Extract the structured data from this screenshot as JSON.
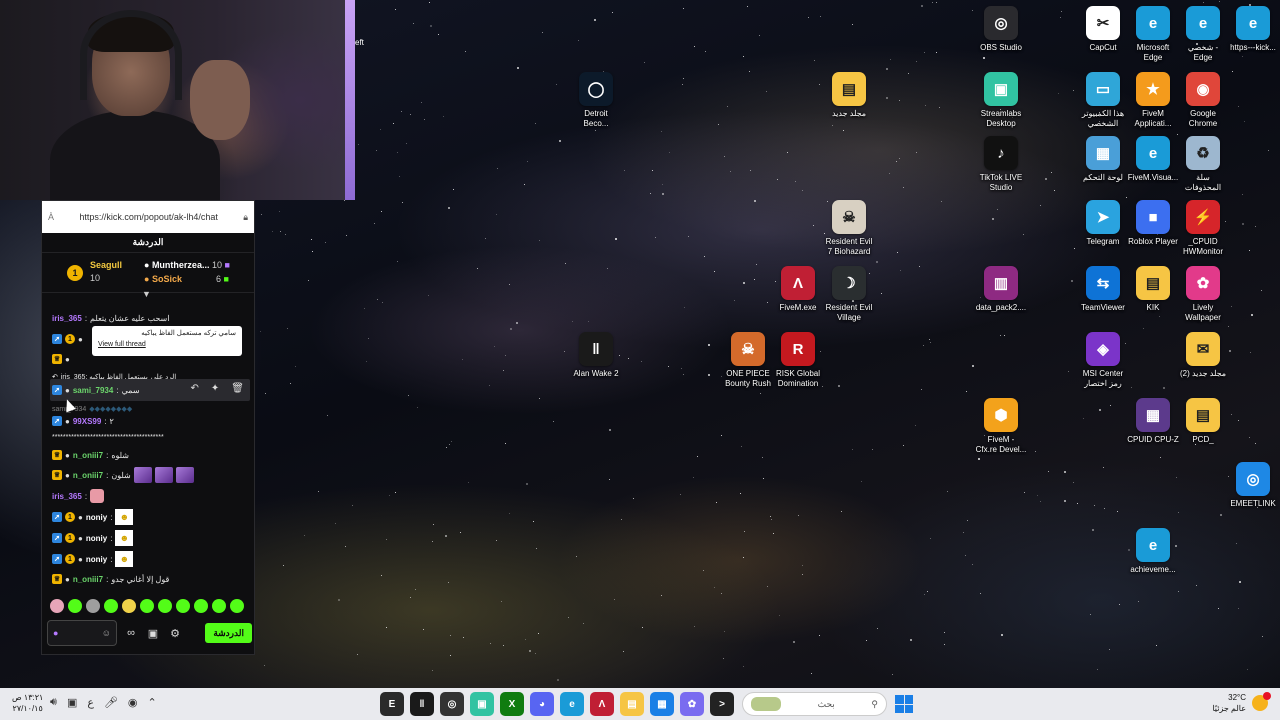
{
  "webcam": {
    "description_visible": false
  },
  "chat": {
    "url": "https://kick.com/popout/ak-lh4/chat",
    "aa_label": "À",
    "title": "الدردشة",
    "leaderboard": [
      {
        "rank": "1",
        "name": "Seagull",
        "value": "10"
      },
      {
        "name": "Muntherzea...",
        "value": "10"
      },
      {
        "name": "SoSick",
        "value": "6"
      }
    ],
    "pinned_arrow": "▼",
    "messages": [
      {
        "user": "iris_365",
        "text": "اسحب عليه عشان يتعلم"
      },
      {
        "user": "sami_7934",
        "text": "سمي"
      },
      {
        "user": "99XS99",
        "text": "٢"
      },
      {
        "user": "n_oniii7",
        "text": "شلوه"
      },
      {
        "user": "n_oniii7",
        "text": "شلون"
      },
      {
        "user": "iris_365",
        "text": ""
      },
      {
        "user": "noniy",
        "text": ""
      },
      {
        "user": "noniy",
        "text": ""
      },
      {
        "user": "noniy",
        "text": ""
      },
      {
        "user": "n_oniii7",
        "text": "قول إلا أغاني جدو"
      }
    ],
    "reply_preview": "iris_365: يستعمل الفاظ يباكيه",
    "reply_to": "الرد على",
    "tooltip_text": "سامي تركه مستعمل الفاظ يباكيه",
    "tooltip_link": "View full thread",
    "faded_row": "sami_7934",
    "stars_row": "*****************************************",
    "send_label": "الدردشة"
  },
  "desktop_icons": [
    {
      "id": "obs",
      "label": "OBS Studio",
      "glyph": "◎",
      "color": "#2a2a2e"
    },
    {
      "id": "capcut",
      "label": "CapCut",
      "glyph": "✂",
      "color": "#ffffff"
    },
    {
      "id": "edge1",
      "label": "Microsoft\nEdge",
      "glyph": "e",
      "color": "#1a9bd7"
    },
    {
      "id": "edge2",
      "label": "شخصي -\nEdge",
      "glyph": "e",
      "color": "#1a9bd7"
    },
    {
      "id": "edge3",
      "label": "https---kick...",
      "glyph": "e",
      "color": "#1a9bd7"
    },
    {
      "id": "detroit",
      "label": "Detroit\nBeco...",
      "glyph": "◯",
      "color": "#0c1a2a"
    },
    {
      "id": "folder1",
      "label": "مجلد جديد",
      "glyph": "▤",
      "color": "#f6c544"
    },
    {
      "id": "streamlabs",
      "label": "Streamlabs\nDesktop",
      "glyph": "▣",
      "color": "#31c3a2"
    },
    {
      "id": "thispc",
      "label": "هذا الكمبيوتر\nالشخصي",
      "glyph": "▭",
      "color": "#2fa6d8"
    },
    {
      "id": "fivemapp",
      "label": "FiveM\nApplicati...",
      "glyph": "★",
      "color": "#f49b1c"
    },
    {
      "id": "chrome",
      "label": "Google\nChrome",
      "glyph": "◉",
      "color": "#e0463a"
    },
    {
      "id": "tiktok",
      "label": "TikTok LIVE\nStudio",
      "glyph": "♪",
      "color": "#111111"
    },
    {
      "id": "controlpanel",
      "label": "لوحة التحكم",
      "glyph": "▦",
      "color": "#4a9fd8"
    },
    {
      "id": "fivemvisual",
      "label": "FiveM.Visua...",
      "glyph": "e",
      "color": "#1a9bd7"
    },
    {
      "id": "recycle",
      "label": "سلة\nالمحذوفات",
      "glyph": "♻",
      "color": "#9db7cf"
    },
    {
      "id": "re7",
      "label": "Resident Evil\n7 Biohazard",
      "glyph": "☠",
      "color": "#d8d0c2"
    },
    {
      "id": "telegram",
      "label": "Telegram",
      "glyph": "➤",
      "color": "#2aa3df"
    },
    {
      "id": "roblox",
      "label": "Roblox Player",
      "glyph": "■",
      "color": "#3c6ff0"
    },
    {
      "id": "hwmonitor",
      "label": "_CPUID\nHWMonitor",
      "glyph": "⚡",
      "color": "#d6252a"
    },
    {
      "id": "fivemexe",
      "label": "FiveM.exe",
      "glyph": "Λ",
      "color": "#c01f34"
    },
    {
      "id": "revillage",
      "label": "Resident Evil\nVillage",
      "glyph": "☽",
      "color": "#2a2e30"
    },
    {
      "id": "datapack",
      "label": "data_pack2....",
      "glyph": "▥",
      "color": "#8e2a82"
    },
    {
      "id": "teamviewer",
      "label": "TeamViewer",
      "glyph": "⇆",
      "color": "#0e73d6"
    },
    {
      "id": "kik",
      "label": "KIK",
      "glyph": "▤",
      "color": "#f6c544"
    },
    {
      "id": "lively",
      "label": "Lively\nWallpaper",
      "glyph": "✿",
      "color": "#e23a8a"
    },
    {
      "id": "alanwake",
      "label": "Alan Wake 2",
      "glyph": "‖",
      "color": "#1a1a1a"
    },
    {
      "id": "onepiece",
      "label": "ONE PIECE\nBounty Rush",
      "glyph": "☠",
      "color": "#d46a2b"
    },
    {
      "id": "risk",
      "label": "RISK Global\nDomination",
      "glyph": "R",
      "color": "#c4191f"
    },
    {
      "id": "msi",
      "label": "MSI Center\nرمز اختصار",
      "glyph": "◈",
      "color": "#7b34c9"
    },
    {
      "id": "folder2",
      "label": "مجلد جديد (2)",
      "glyph": "✉",
      "color": "#f6c544"
    },
    {
      "id": "fivemcfx",
      "label": "FiveM -\nCfx.re Devel...",
      "glyph": "⬢",
      "color": "#f3a21b"
    },
    {
      "id": "cpuz",
      "label": "CPUID CPU-Z",
      "glyph": "▦",
      "color": "#5c3a8c"
    },
    {
      "id": "pcd",
      "label": "PCD_",
      "glyph": "▤",
      "color": "#f6c544"
    },
    {
      "id": "emeetlink",
      "label": "EMEETLINK",
      "glyph": "◎",
      "color": "#1e88e5"
    },
    {
      "id": "achieve",
      "label": "achieveme...",
      "glyph": "e",
      "color": "#1a9bd7"
    }
  ],
  "webcam_edge_text": "eft",
  "taskbar": {
    "time": "١٣:٢١ ص",
    "date": "٢٧/١٠/١٥",
    "search_placeholder": "بحث",
    "temperature": "32°C",
    "weather_text": "عالم جزئيًا",
    "apps": [
      {
        "id": "epic",
        "glyph": "E",
        "color": "#2a2a2a"
      },
      {
        "id": "alanwake",
        "glyph": "‖",
        "color": "#1a1a1a"
      },
      {
        "id": "obs",
        "glyph": "◎",
        "color": "#333333"
      },
      {
        "id": "streamlabs",
        "glyph": "▣",
        "color": "#31c3a2"
      },
      {
        "id": "xbox",
        "glyph": "X",
        "color": "#107c10"
      },
      {
        "id": "discord",
        "glyph": "◕",
        "color": "#5865f2"
      },
      {
        "id": "edge",
        "glyph": "e",
        "color": "#1a9bd7"
      },
      {
        "id": "fivem",
        "glyph": "Λ",
        "color": "#c01f34"
      },
      {
        "id": "explorer",
        "glyph": "▤",
        "color": "#f6c544"
      },
      {
        "id": "store",
        "glyph": "▦",
        "color": "#1a7fe6"
      },
      {
        "id": "copilot",
        "glyph": "✿",
        "color": "#7a6cf0"
      },
      {
        "id": "cmd",
        "glyph": ">",
        "color": "#222222"
      }
    ]
  }
}
